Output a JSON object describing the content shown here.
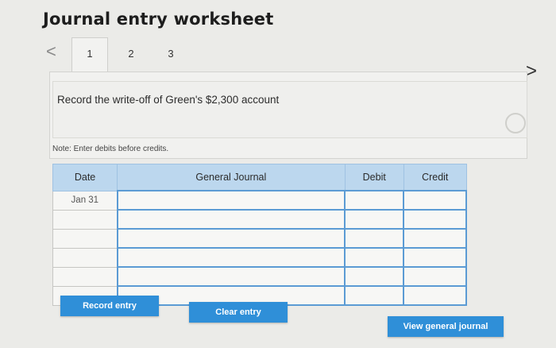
{
  "header": {
    "title": "Journal entry worksheet"
  },
  "tabs": [
    {
      "label": "1"
    },
    {
      "label": "2"
    },
    {
      "label": "3"
    }
  ],
  "nav": {
    "prev_glyph": "<",
    "next_glyph": ">"
  },
  "instruction": "Record the write-off of Green's $2,300 account",
  "note": "Note: Enter debits before credits.",
  "journal": {
    "columns": {
      "date": "Date",
      "account": "General Journal",
      "debit": "Debit",
      "credit": "Credit"
    },
    "rows": [
      {
        "date": "Jan 31",
        "account": "",
        "debit": "",
        "credit": ""
      },
      {
        "date": "",
        "account": "",
        "debit": "",
        "credit": ""
      },
      {
        "date": "",
        "account": "",
        "debit": "",
        "credit": ""
      },
      {
        "date": "",
        "account": "",
        "debit": "",
        "credit": ""
      },
      {
        "date": "",
        "account": "",
        "debit": "",
        "credit": ""
      },
      {
        "date": "",
        "account": "",
        "debit": "",
        "credit": ""
      }
    ]
  },
  "buttons": {
    "record": "Record entry",
    "clear": "Clear entry",
    "view": "View general journal"
  },
  "colors": {
    "accent": "#2f8fd8",
    "header_bg": "#bcd7ee",
    "input_border": "#5b9bd4"
  }
}
